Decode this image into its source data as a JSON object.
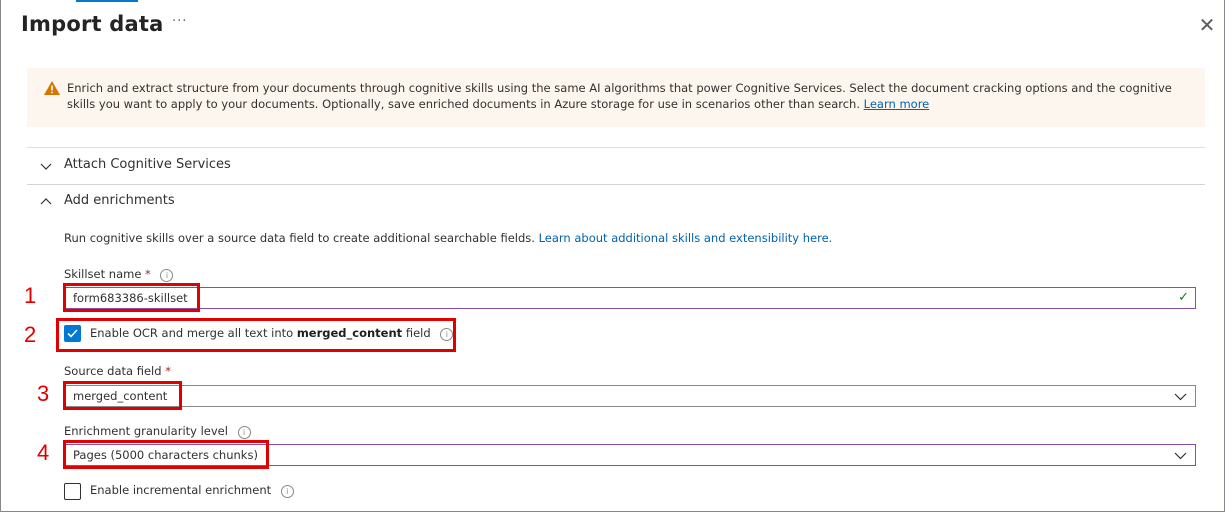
{
  "window": {
    "title": "Import data",
    "more_label": "···",
    "close_label": "✕"
  },
  "banner": {
    "text": "Enrich and extract structure from your documents through cognitive skills using the same AI algorithms that power Cognitive Services. Select the document cracking options and the cognitive skills you want to apply to your documents. Optionally, save enriched documents in Azure storage for use in scenarios other than search.",
    "link": "Learn more"
  },
  "sections": {
    "attach": {
      "label": "Attach Cognitive Services",
      "expanded": false
    },
    "enrich": {
      "label": "Add enrichments",
      "expanded": true
    }
  },
  "enrichments": {
    "description": "Run cognitive skills over a source data field to create additional searchable fields.",
    "description_link": "Learn about additional skills and extensibility here.",
    "skillset": {
      "label": "Skillset name",
      "required": "*",
      "value": "form683386-skillset"
    },
    "ocr": {
      "label_prefix": "Enable OCR and merge all text into ",
      "label_bold": "merged_content",
      "label_suffix": " field",
      "checked": true
    },
    "source_field": {
      "label": "Source data field",
      "required": "*",
      "value": "merged_content"
    },
    "granularity": {
      "label": "Enrichment granularity level",
      "value": "Pages (5000 characters chunks)"
    },
    "incremental": {
      "label": "Enable incremental enrichment",
      "checked": false
    }
  },
  "callouts": [
    "1",
    "2",
    "3",
    "4"
  ],
  "icons": {
    "warning": "warning-triangle-icon",
    "info": "info-icon",
    "valid": "checkmark-icon",
    "chevron": "chevron-icon"
  },
  "colors": {
    "accent": "#0078d4",
    "callout": "#e00000",
    "warning": "#d47500",
    "valid": "#107c10",
    "focus_border": "#8a4fa5"
  }
}
